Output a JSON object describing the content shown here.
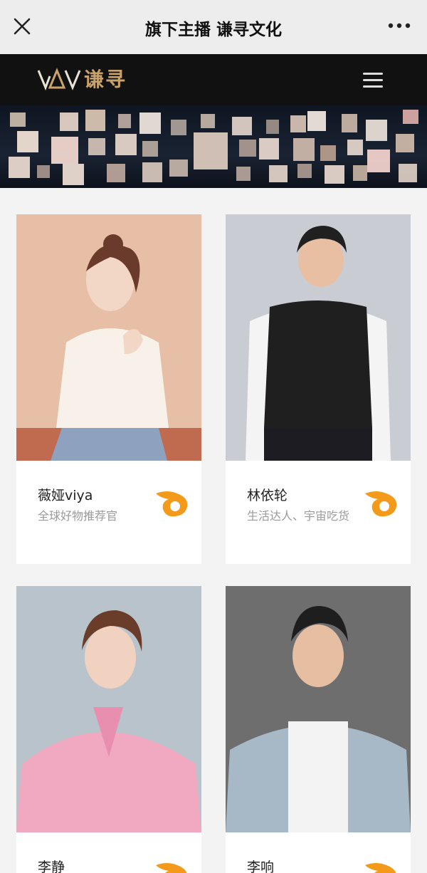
{
  "nav": {
    "title": "旗下主播 谦寻文化",
    "close_icon": "close-icon",
    "more_icon": "more-icon"
  },
  "brand": {
    "logo_text": "谦寻",
    "logo_mark": "VAV",
    "menu_icon": "hamburger-icon",
    "accent": "#c9a26a"
  },
  "anchors": [
    {
      "name": "薇娅viya",
      "desc": "全球好物推荐官",
      "bg": "#e7bfa6"
    },
    {
      "name": "林依轮",
      "desc": "生活达人、宇宙吃货",
      "bg": "#c9cdd3"
    },
    {
      "name": "李静",
      "desc": "",
      "bg": "#b9c3cc"
    },
    {
      "name": "李响",
      "desc": "",
      "bg": "#6e6e6e"
    }
  ],
  "colors": {
    "flame": "#f39a1b"
  }
}
